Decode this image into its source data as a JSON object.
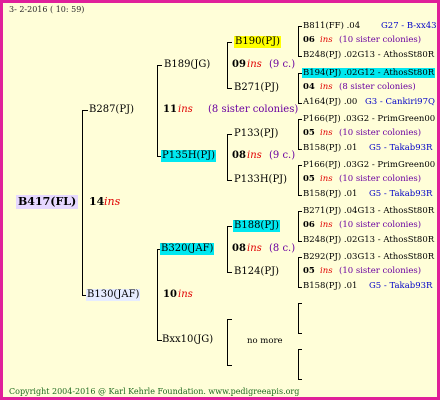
{
  "header": {
    "date": "3- 2-2016 ( 10: 59)"
  },
  "footer": {
    "copyright": "Copyright 2004-2016 @ Karl Kehrle Foundation.   www.pedigreeapis.org"
  },
  "root": {
    "id": "B417(FL)",
    "num": "14",
    "ins": "ins"
  },
  "g1": [
    {
      "id": "B287(PJ)",
      "num": "11",
      "ins": "ins",
      "note": "(8 sister colonies)"
    },
    {
      "id": "B130(JAF)",
      "num": "10",
      "ins": "ins"
    }
  ],
  "g2": [
    {
      "id": "B189(JG)",
      "num": "09",
      "ins": "ins",
      "note": "(9 c.)"
    },
    {
      "id": "P135H(PJ)",
      "num": "08",
      "ins": "ins",
      "note": "(9 c.)"
    },
    {
      "id": "B320(JAF)",
      "num": "08",
      "ins": "ins",
      "note": "(8 c.)"
    },
    {
      "id": "Bxx10(JG)",
      "nomore": "no more"
    }
  ],
  "g3": [
    {
      "id": "B190(PJ)"
    },
    {
      "id": "B271(PJ)"
    },
    {
      "id": "P133(PJ)"
    },
    {
      "id": "P133H(PJ)"
    },
    {
      "id": "B188(PJ)"
    },
    {
      "id": "B124(PJ)"
    }
  ],
  "g4": [
    {
      "a": "B811(FF) .04",
      "a2": "G27 - B-xx43",
      "n": "06",
      "ins": "ins",
      "s": "(10 sister colonies)",
      "b": "B248(PJ) .02G13 - AthosSt80R"
    },
    {
      "a": "B194(PJ) .02G12 - AthosSt80R",
      "n": "04",
      "ins": "ins",
      "s": "(8 sister colonies)",
      "b": "A164(PJ) .00",
      "b2": "G3 - Cankiri97Q"
    },
    {
      "a": "P166(PJ) .03G2 - PrimGreen00",
      "n": "05",
      "ins": "ins",
      "s": "(10 sister colonies)",
      "b": "B158(PJ) .01",
      "b2": "G5 - Takab93R"
    },
    {
      "a": "P166(PJ) .03G2 - PrimGreen00",
      "n": "05",
      "ins": "ins",
      "s": "(10 sister colonies)",
      "b": "B158(PJ) .01",
      "b2": "G5 - Takab93R"
    },
    {
      "a": "B271(PJ) .04G13 - AthosSt80R",
      "n": "06",
      "ins": "ins",
      "s": "(10 sister colonies)",
      "b": "B248(PJ) .02G13 - AthosSt80R"
    },
    {
      "a": "B292(PJ) .03G13 - AthosSt80R",
      "n": "05",
      "ins": "ins",
      "s": "(10 sister colonies)",
      "b": "B158(PJ) .01",
      "b2": "G5 - Takab93R"
    }
  ]
}
